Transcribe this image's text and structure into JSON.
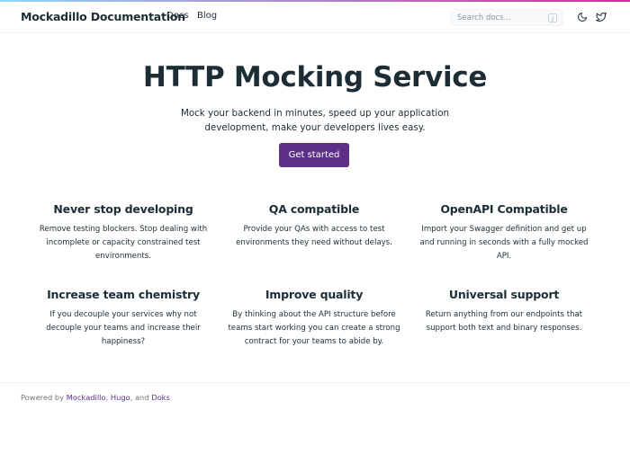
{
  "header": {
    "brand": "Mockadillo Documentation",
    "nav": [
      "Docs",
      "Blog"
    ],
    "search_placeholder": "Search docs...",
    "search_shortcut": "/",
    "icons": [
      "moon-icon",
      "twitter-icon"
    ]
  },
  "hero": {
    "title": "HTTP Mocking Service",
    "lead": "Mock your backend in minutes, speed up your application development, make your developers lives easy.",
    "cta_label": "Get started"
  },
  "features": [
    {
      "title": "Never stop developing",
      "text": "Remove testing blockers. Stop dealing with incomplete or capacity constrained test environments."
    },
    {
      "title": "QA compatible",
      "text": "Provide your QAs with access to test environments they need without delays."
    },
    {
      "title": "OpenAPI Compatible",
      "text": "Import your Swagger definition and get up and running in seconds with a fully mocked API."
    },
    {
      "title": "Increase team chemistry",
      "text": "If you decouple your services why not decouple your teams and increase their happiness?"
    },
    {
      "title": "Improve quality",
      "text": "By thinking about the API structure before teams start working you can create a strong contract for your teams to abide by."
    },
    {
      "title": "Universal support",
      "text": "Return anything from our endpoints that support both text and binary responses."
    }
  ],
  "footer": {
    "prefix": "Powered by",
    "links": [
      "Mockadillo",
      "Hugo",
      "Doks"
    ],
    "sep1": ",",
    "sep2": ", and"
  },
  "colors": {
    "accent": "#5d2f86",
    "text": "#1d2d35"
  }
}
